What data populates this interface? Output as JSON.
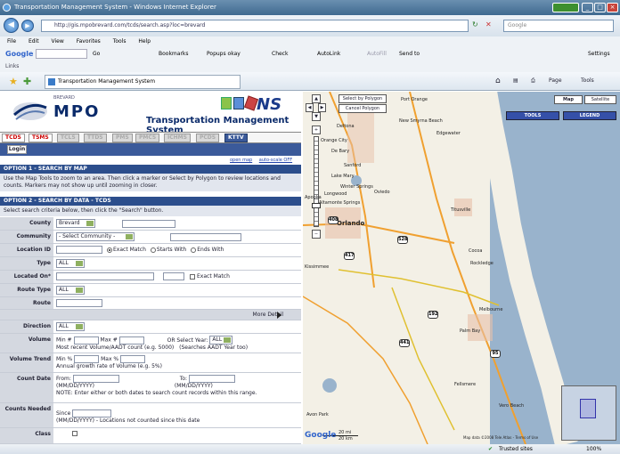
{
  "window": {
    "title": "Transportation Management System - Windows Internet Explorer"
  },
  "address": {
    "url": "http://gis.mpobrevard.com/tcds/search.asp?loc=brevard",
    "search_placeholder": "Google"
  },
  "menu": [
    "File",
    "Edit",
    "View",
    "Favorites",
    "Tools",
    "Help"
  ],
  "google_toolbar": {
    "label": "Google",
    "go": "Go",
    "bookmarks": "Bookmarks",
    "popups": "Popups okay",
    "check": "Check",
    "autolink": "AutoLink",
    "autofill": "AutoFill",
    "sendto": "Send to",
    "settings": "Settings"
  },
  "links_label": "Links",
  "tab": {
    "title": "Transportation Management System"
  },
  "ie_tools": {
    "page": "Page",
    "tools": "Tools"
  },
  "site": {
    "brand_small": "BREVARD",
    "brand": "MPO",
    "title": "Transportation Management System",
    "partner": "NS",
    "nav": [
      {
        "label": "TCDS",
        "state": "red"
      },
      {
        "label": "TSMS",
        "state": "red"
      },
      {
        "label": "TCLS",
        "state": "off"
      },
      {
        "label": "TTDS",
        "state": "off"
      },
      {
        "label": "PMS",
        "state": "off"
      },
      {
        "label": "PMCS",
        "state": "off"
      },
      {
        "label": "ICHMS",
        "state": "off"
      },
      {
        "label": "PCDS",
        "state": "off"
      },
      {
        "label": "KTTV",
        "state": "on"
      }
    ],
    "login": "Login",
    "map_links": [
      "open map",
      "auto-scale OFF"
    ]
  },
  "option1": {
    "heading": "OPTION 1 - SEARCH BY MAP",
    "text": "Use the Map Tools to zoom to an area. Then click a marker or Select by Polygon to review locations and counts. Markers may not show up until zooming in closer."
  },
  "option2": {
    "heading": "OPTION 2 - SEARCH BY DATA - TCDS",
    "text": "Select search criteria below, then click the \"Search\" button."
  },
  "form": {
    "county_label": "County",
    "county_value": "Brevard",
    "community_label": "Community",
    "community_value": "- Select Community -",
    "location_label": "Location ID",
    "match_exact": "Exact Match",
    "match_starts": "Starts With",
    "match_ends": "Ends With",
    "type_label": "Type",
    "type_value": "ALL",
    "located_label": "Located On*",
    "located_exact": "Exact Match",
    "route_type_label": "Route Type",
    "route_type_value": "ALL",
    "route_label": "Route",
    "more_detail": "More Detail",
    "direction_label": "Direction",
    "direction_value": "ALL",
    "volume_label": "Volume",
    "volume_min": "Min #",
    "volume_max": "Max #",
    "volume_note": "Most recent Volume/AADT count (e.g. 5000)",
    "volume_or": "OR Select Year:",
    "volume_year": "ALL",
    "volume_or_note": "(Searches AADT Year too)",
    "trend_label": "Volume Trend",
    "trend_min": "Min %",
    "trend_max": "Max %",
    "trend_note": "Annual growth rate of Volume (e.g. 5%)",
    "count_date_label": "Count Date",
    "from": "From:",
    "to": "To:",
    "date_fmt": "(MM/DD/YYYY)",
    "date_note": "NOTE: Enter either or both dates to search count records within this range.",
    "needed_label": "Counts Needed",
    "since": "Since",
    "needed_note": "(MM/DD/YYYY) - Locations not counted since this date",
    "class_label": "Class"
  },
  "map": {
    "select_polygon": "Select by Polygon",
    "cancel_polygon": "Cancel Polygon",
    "map_btn": "Map",
    "satellite_btn": "Satellite",
    "tools": "TOOLS",
    "legend": "LEGEND",
    "places": [
      "Port Orange",
      "New Smyrna Beach",
      "Edgewater",
      "Deltona",
      "Orange City",
      "De Bary",
      "Sanford",
      "Lake Mary",
      "Oviedo",
      "Winter Springs",
      "Longwood",
      "Altamonte Springs",
      "Apopka",
      "Orlando",
      "Titusville",
      "Kissimmee",
      "Cocoa",
      "Rockledge",
      "Melbourne",
      "Palm Bay",
      "Vero Beach",
      "Fellsmere",
      "Avon Park"
    ],
    "routes": [
      "408",
      "528",
      "417",
      "192",
      "441",
      "95"
    ],
    "scale_mi": "20 mi",
    "scale_km": "20 km",
    "copyright": "Map data ©2008 Tele Atlas - Terms of Use",
    "google": "Google"
  },
  "status": {
    "zone": "Trusted sites",
    "zoom": "100%"
  }
}
